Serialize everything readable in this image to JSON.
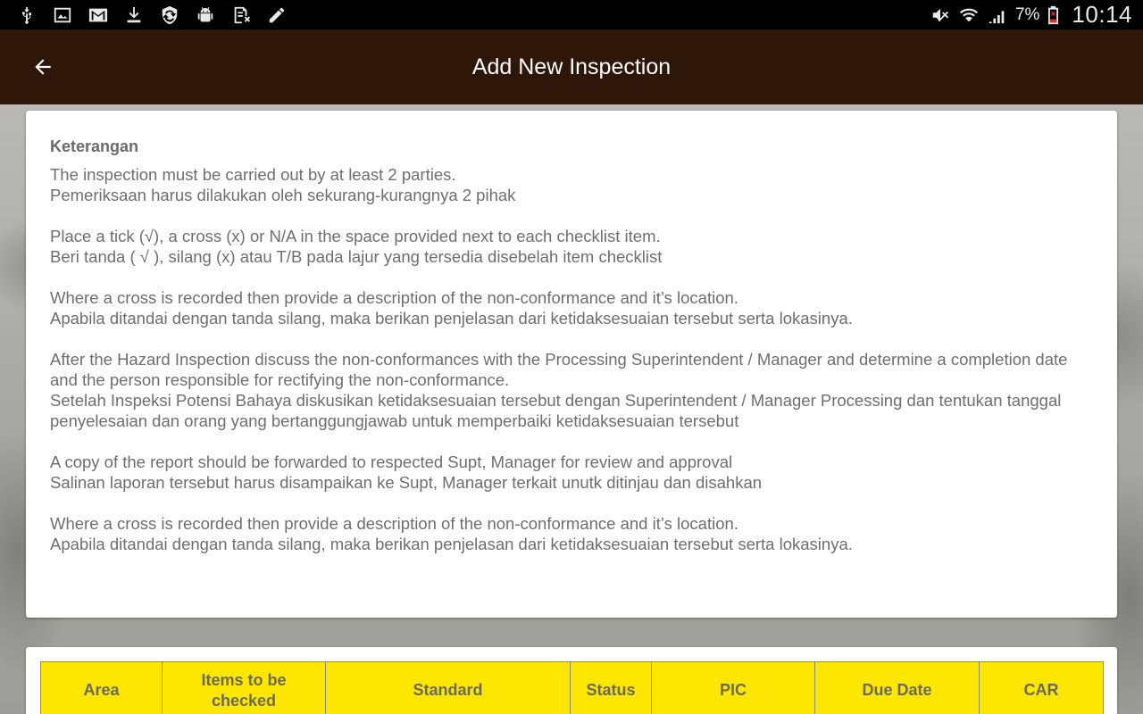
{
  "status_bar": {
    "icons_left": [
      "usb-icon",
      "image-icon",
      "gmail-icon",
      "download-icon",
      "shield-sync-icon",
      "android-debug-icon",
      "file-error-icon",
      "pencil-icon"
    ],
    "icons_right": [
      "mute-icon",
      "wifi-icon",
      "signal-icon",
      "battery-low-icon"
    ],
    "battery_pct": "7%",
    "time": "10:14"
  },
  "app_bar": {
    "title": "Add New Inspection",
    "back_icon": "arrow-back-icon"
  },
  "info": {
    "heading": "Keterangan",
    "paragraphs": [
      {
        "en": "The inspection must be carried out by at least 2 parties.",
        "id": "Pemeriksaan harus dilakukan oleh sekurang-kurangnya 2 pihak"
      },
      {
        "en": "Place a tick (√), a cross (x) or N/A in the space provided next to each checklist item.",
        "id": "Beri tanda ( √ ), silang (x) atau T/B pada lajur yang tersedia disebelah item checklist"
      },
      {
        "en": "Where a cross is recorded then provide a description of the non-conformance and it’s location.",
        "id": "Apabila ditandai dengan tanda silang, maka berikan penjelasan dari ketidaksesuaian tersebut serta lokasinya."
      },
      {
        "en": "After the Hazard Inspection discuss the non-conformances with the Processing Superintendent / Manager and determine a completion date and the person responsible for rectifying the non-conformance.",
        "id": "Setelah Inspeksi Potensi Bahaya diskusikan ketidaksesuaian tersebut dengan Superintendent / Manager Processing dan tentukan tanggal penyelesaian dan orang yang bertanggungjawab untuk memperbaiki ketidaksesuaian tersebut"
      },
      {
        "en": "A copy of the report should be forwarded to respected Supt, Manager for review and approval",
        "id": "Salinan laporan tersebut harus disampaikan ke Supt, Manager terkait unutk ditinjau dan disahkan"
      },
      {
        "en": "Where a cross is recorded then provide a description of the non-conformance and it’s location.",
        "id": "Apabila ditandai dengan tanda silang, maka berikan penjelasan dari ketidaksesuaian tersebut serta lokasinya."
      }
    ]
  },
  "table": {
    "headers": [
      "Area",
      "Items to be checked",
      "Standard",
      "Status",
      "PIC",
      "Due Date",
      "CAR"
    ],
    "header_color": "#fde700"
  },
  "colors": {
    "app_bar": "#2e1608",
    "status_bar": "#000000",
    "body_text": "#6e6e6e"
  }
}
